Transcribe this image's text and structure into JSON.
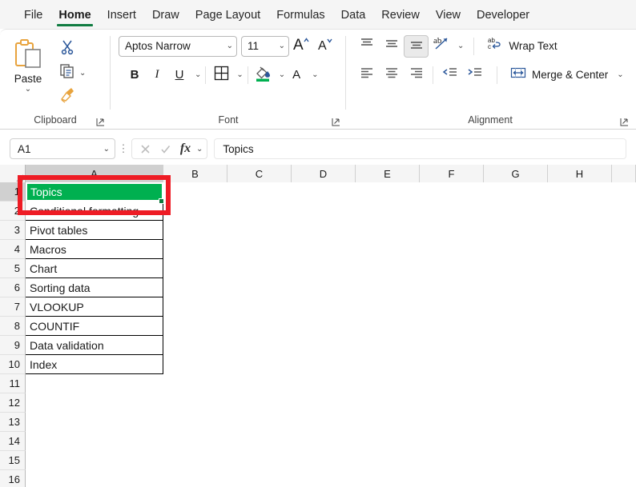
{
  "app": {
    "tabs": [
      {
        "label": "File",
        "active": false
      },
      {
        "label": "Home",
        "active": true
      },
      {
        "label": "Insert",
        "active": false
      },
      {
        "label": "Draw",
        "active": false
      },
      {
        "label": "Page Layout",
        "active": false
      },
      {
        "label": "Formulas",
        "active": false
      },
      {
        "label": "Data",
        "active": false
      },
      {
        "label": "Review",
        "active": false
      },
      {
        "label": "View",
        "active": false
      },
      {
        "label": "Developer",
        "active": false
      }
    ],
    "accent_green": "#107C41",
    "fill_green": "#00B050",
    "annotation_red": "#EE1C25"
  },
  "ribbon": {
    "clipboard": {
      "label": "Clipboard",
      "paste_label": "Paste",
      "paste_icon": "paste-icon",
      "paste_caret_icon": "chevron-down-icon",
      "cut_icon": "scissors-icon",
      "copy_icon": "copy-icon",
      "copy_caret_icon": "chevron-down-icon",
      "format_painter_icon": "format-painter-icon",
      "launcher_icon": "dialog-launcher-icon"
    },
    "font": {
      "label": "Font",
      "font_name": "Aptos Narrow",
      "font_size": "11",
      "increase_font_icon": "increase-font-size-icon",
      "decrease_font_icon": "decrease-font-size-icon",
      "bold_label": "B",
      "italic_label": "I",
      "underline_label": "U",
      "underline_caret_icon": "chevron-down-icon",
      "borders_icon": "borders-icon",
      "borders_caret_icon": "chevron-down-icon",
      "fill_color_icon": "fill-color-icon",
      "fill_color_caret_icon": "chevron-down-icon",
      "font_color_label": "A",
      "font_color_caret_icon": "chevron-down-icon",
      "launcher_icon": "dialog-launcher-icon"
    },
    "alignment": {
      "label": "Alignment",
      "top_align_icon": "align-top-icon",
      "middle_align_icon": "align-middle-icon",
      "bottom_align_icon": "align-bottom-icon",
      "orientation_icon": "orientation-icon",
      "orientation_caret_icon": "chevron-down-icon",
      "wrap_text_label": "Wrap Text",
      "wrap_text_icon": "wrap-text-icon",
      "align_left_icon": "align-left-icon",
      "align_center_icon": "align-center-icon",
      "align_right_icon": "align-right-icon",
      "decrease_indent_icon": "decrease-indent-icon",
      "increase_indent_icon": "increase-indent-icon",
      "merge_center_label": "Merge & Center",
      "merge_center_icon": "merge-center-icon",
      "merge_caret_icon": "chevron-down-icon",
      "launcher_icon": "dialog-launcher-icon"
    }
  },
  "formula_bar": {
    "name_box_value": "A1",
    "name_box_caret_icon": "chevron-down-icon",
    "kebab_icon": "more-options-icon",
    "cancel_icon": "cancel-icon",
    "enter_icon": "enter-icon",
    "fx_label": "fx",
    "fx_caret_icon": "chevron-down-icon",
    "formula_value": "Topics"
  },
  "grid": {
    "columns": [
      "A",
      "B",
      "C",
      "D",
      "E",
      "F",
      "G",
      "H"
    ],
    "selected_column": "A",
    "selected_row": "1",
    "selected_cell": "A1",
    "rows": [
      {
        "num": "1",
        "a": "Topics",
        "filled": true
      },
      {
        "num": "2",
        "a": "Conditional formatting",
        "filled": true
      },
      {
        "num": "3",
        "a": "Pivot tables",
        "filled": true
      },
      {
        "num": "4",
        "a": "Macros",
        "filled": true
      },
      {
        "num": "5",
        "a": "Chart",
        "filled": true
      },
      {
        "num": "6",
        "a": "Sorting data",
        "filled": true
      },
      {
        "num": "7",
        "a": "VLOOKUP",
        "filled": true
      },
      {
        "num": "8",
        "a": "COUNTIF",
        "filled": true
      },
      {
        "num": "9",
        "a": "Data validation",
        "filled": true
      },
      {
        "num": "10",
        "a": "Index",
        "filled": true
      },
      {
        "num": "11",
        "a": "",
        "filled": false
      },
      {
        "num": "12",
        "a": "",
        "filled": false
      },
      {
        "num": "13",
        "a": "",
        "filled": false
      },
      {
        "num": "14",
        "a": "",
        "filled": false
      },
      {
        "num": "15",
        "a": "",
        "filled": false
      },
      {
        "num": "16",
        "a": "",
        "filled": false
      }
    ],
    "a1_text": "Topics"
  }
}
